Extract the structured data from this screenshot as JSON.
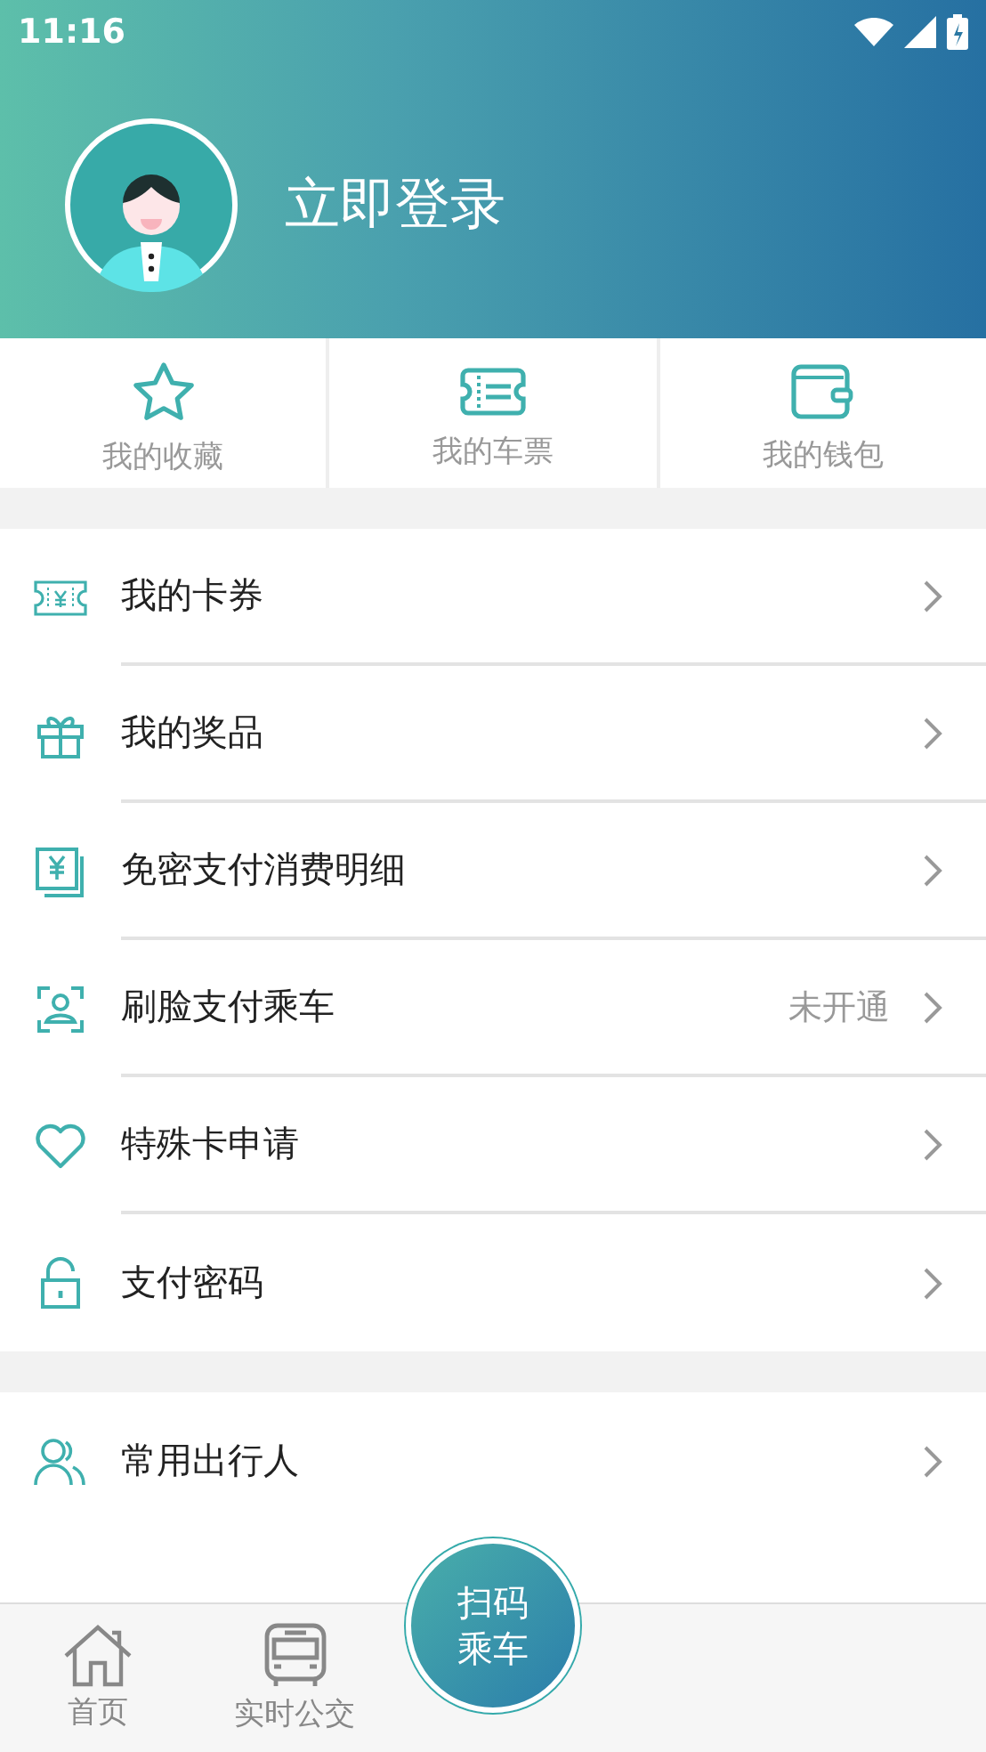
{
  "status_bar": {
    "time": "11:16"
  },
  "profile": {
    "login_label": "立即登录"
  },
  "quick_links": [
    {
      "label": "我的收藏"
    },
    {
      "label": "我的车票"
    },
    {
      "label": "我的钱包"
    }
  ],
  "menu_groups": [
    [
      {
        "label": "我的卡券"
      },
      {
        "label": "我的奖品"
      },
      {
        "label": "免密支付消费明细"
      },
      {
        "label": "刷脸支付乘车",
        "status": "未开通"
      },
      {
        "label": "特殊卡申请"
      },
      {
        "label": "支付密码"
      }
    ],
    [
      {
        "label": "常用出行人"
      }
    ]
  ],
  "bottom_nav": {
    "tabs": [
      {
        "label": "首页"
      },
      {
        "label": "实时公交"
      }
    ],
    "scan_button": "扫码乘车"
  }
}
